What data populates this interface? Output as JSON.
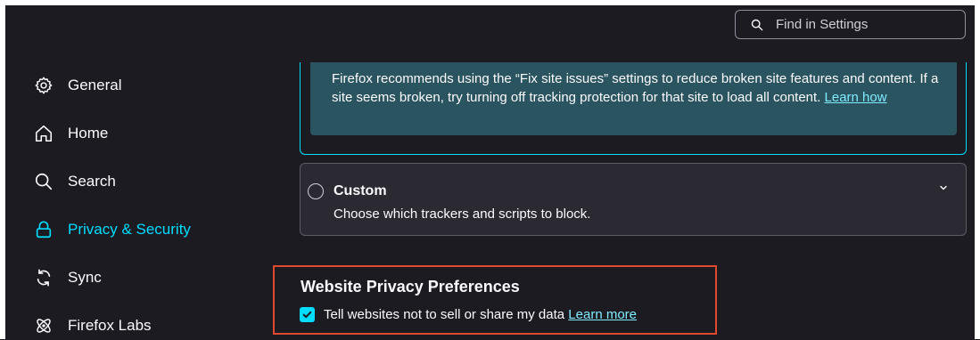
{
  "search": {
    "placeholder": "Find in Settings"
  },
  "sidebar": {
    "items": [
      {
        "label": "General",
        "icon": "gear-icon"
      },
      {
        "label": "Home",
        "icon": "home-icon"
      },
      {
        "label": "Search",
        "icon": "search-icon"
      },
      {
        "label": "Privacy & Security",
        "icon": "lock-icon",
        "active": true
      },
      {
        "label": "Sync",
        "icon": "sync-icon"
      },
      {
        "label": "Firefox Labs",
        "icon": "labs-icon"
      }
    ]
  },
  "tracking_info": {
    "text": "Firefox recommends using the “Fix site issues” settings to reduce broken site features and content. If a site seems broken, try turning off tracking protection for that site to load all content.",
    "link": "Learn how"
  },
  "custom": {
    "title": "Custom",
    "description": "Choose which trackers and scripts to block.",
    "selected": false
  },
  "website_privacy": {
    "title": "Website Privacy Preferences",
    "checkbox_label": "Tell websites not to sell or share my data",
    "checked": true,
    "link": "Learn more"
  },
  "colors": {
    "accent": "#00ddff",
    "background": "#1c1b22",
    "highlight_border": "#e0492e"
  }
}
